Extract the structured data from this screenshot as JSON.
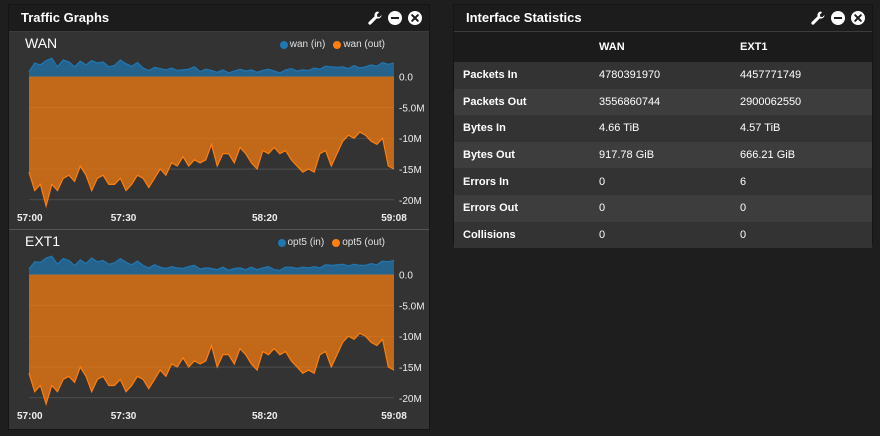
{
  "traffic_widget": {
    "title": "Traffic Graphs",
    "colors": {
      "in": "#1f77b4",
      "out": "#ff7f0e"
    },
    "graphs": [
      {
        "name": "WAN",
        "legend_in": "wan (in)",
        "legend_out": "wan (out)"
      },
      {
        "name": "EXT1",
        "legend_in": "opt5 (in)",
        "legend_out": "opt5 (out)"
      }
    ]
  },
  "stats_widget": {
    "title": "Interface Statistics",
    "columns": [
      "",
      "WAN",
      "EXT1"
    ],
    "rows": [
      {
        "label": "Packets In",
        "wan": "4780391970",
        "ext1": "4457771749"
      },
      {
        "label": "Packets Out",
        "wan": "3556860744",
        "ext1": "2900062550"
      },
      {
        "label": "Bytes In",
        "wan": "4.66 TiB",
        "ext1": "4.57 TiB"
      },
      {
        "label": "Bytes Out",
        "wan": "917.78 GiB",
        "ext1": "666.21 GiB"
      },
      {
        "label": "Errors In",
        "wan": "0",
        "ext1": "6"
      },
      {
        "label": "Errors Out",
        "wan": "0",
        "ext1": "0"
      },
      {
        "label": "Collisions",
        "wan": "0",
        "ext1": "0"
      }
    ]
  },
  "chart_data": [
    {
      "type": "area",
      "title": "WAN",
      "x_tick_labels": [
        "57:00",
        "57:30",
        "58:20",
        "59:08"
      ],
      "y_tick_labels": [
        "0.0",
        "-5.0M",
        "-10M",
        "-15M",
        "-20M"
      ],
      "ylim": [
        -21,
        4
      ],
      "x": [
        0,
        2,
        4,
        6,
        8,
        10,
        12,
        14,
        16,
        18,
        20,
        22,
        24,
        26,
        28,
        30,
        32,
        34,
        36,
        38,
        40,
        42,
        44,
        46,
        48,
        50,
        52,
        54,
        56,
        58,
        60,
        62,
        64,
        66,
        68,
        70,
        72,
        74,
        76,
        78,
        80,
        82,
        84,
        86,
        88,
        90,
        92,
        94,
        96,
        98,
        100,
        102,
        104,
        106,
        108,
        110,
        112,
        114,
        116,
        118,
        120,
        122,
        124,
        126,
        128
      ],
      "series": [
        {
          "name": "wan (in)",
          "values": [
            0.8,
            2.2,
            1.9,
            2.6,
            3.0,
            1.6,
            2.7,
            2.4,
            1.6,
            2.5,
            1.9,
            2.6,
            2.2,
            2.4,
            1.6,
            1.8,
            2.7,
            2.1,
            1.7,
            2.3,
            1.4,
            1.0,
            1.5,
            1.3,
            1.1,
            1.4,
            1.0,
            1.1,
            1.2,
            1.6,
            0.8,
            1.2,
            1.0,
            0.7,
            1.1,
            0.6,
            0.9,
            1.2,
            0.9,
            1.1,
            0.7,
            1.0,
            1.2,
            0.9,
            0.6,
            1.1,
            1.3,
            0.9,
            1.1,
            1.0,
            1.4,
            1.2,
            1.7,
            1.6,
            1.5,
            1.6,
            1.3,
            1.8,
            1.4,
            1.6,
            1.9,
            1.7,
            2.3,
            2.0,
            2.2
          ]
        },
        {
          "name": "wan (out)",
          "values": [
            -15.5,
            -18.5,
            -17.5,
            -21.0,
            -17.5,
            -18.5,
            -16.5,
            -16.0,
            -17.0,
            -14.5,
            -16.0,
            -18.5,
            -16.5,
            -16.0,
            -17.5,
            -17.5,
            -16.5,
            -18.5,
            -17.5,
            -16.0,
            -16.5,
            -18.0,
            -16.5,
            -15.0,
            -16.0,
            -14.0,
            -14.5,
            -13.0,
            -14.5,
            -13.5,
            -14.0,
            -13.5,
            -11.0,
            -14.5,
            -12.5,
            -12.5,
            -14.0,
            -11.5,
            -12.5,
            -14.0,
            -15.0,
            -12.0,
            -12.5,
            -11.5,
            -12.5,
            -12.0,
            -13.5,
            -14.5,
            -15.5,
            -15.0,
            -15.5,
            -12.5,
            -12.0,
            -14.5,
            -12.5,
            -10.5,
            -9.5,
            -10.0,
            -9.0,
            -9.5,
            -10.5,
            -11.0,
            -10.0,
            -14.5,
            -15.0
          ]
        }
      ]
    },
    {
      "type": "area",
      "title": "EXT1",
      "x_tick_labels": [
        "57:00",
        "57:30",
        "58:20",
        "59:08"
      ],
      "y_tick_labels": [
        "0.0",
        "-5.0M",
        "-10M",
        "-15M",
        "-20M"
      ],
      "ylim": [
        -21,
        4
      ],
      "x": [
        0,
        2,
        4,
        6,
        8,
        10,
        12,
        14,
        16,
        18,
        20,
        22,
        24,
        26,
        28,
        30,
        32,
        34,
        36,
        38,
        40,
        42,
        44,
        46,
        48,
        50,
        52,
        54,
        56,
        58,
        60,
        62,
        64,
        66,
        68,
        70,
        72,
        74,
        76,
        78,
        80,
        82,
        84,
        86,
        88,
        90,
        92,
        94,
        96,
        98,
        100,
        102,
        104,
        106,
        108,
        110,
        112,
        114,
        116,
        118,
        120,
        122,
        124,
        126,
        128
      ],
      "series": [
        {
          "name": "opt5 (in)",
          "values": [
            0.9,
            2.1,
            2.0,
            2.7,
            3.0,
            1.7,
            2.6,
            2.3,
            1.5,
            2.4,
            1.8,
            2.7,
            2.1,
            2.3,
            1.7,
            1.9,
            2.6,
            2.0,
            1.6,
            2.2,
            1.5,
            1.1,
            1.6,
            1.2,
            1.0,
            1.3,
            1.1,
            1.0,
            1.3,
            1.5,
            0.9,
            1.1,
            1.0,
            0.8,
            1.2,
            0.7,
            1.0,
            1.1,
            0.8,
            1.2,
            0.8,
            1.1,
            1.3,
            0.8,
            0.7,
            1.2,
            1.2,
            1.0,
            1.2,
            1.1,
            1.3,
            1.1,
            1.6,
            1.5,
            1.6,
            1.7,
            1.4,
            1.7,
            1.5,
            1.5,
            1.8,
            1.6,
            2.2,
            2.1,
            2.3
          ]
        },
        {
          "name": "opt5 (out)",
          "values": [
            -16.0,
            -19.0,
            -18.0,
            -21.0,
            -18.0,
            -19.0,
            -17.0,
            -16.5,
            -17.5,
            -15.0,
            -16.5,
            -19.0,
            -17.0,
            -16.5,
            -18.0,
            -18.0,
            -17.0,
            -19.0,
            -18.0,
            -16.5,
            -17.0,
            -18.5,
            -17.0,
            -15.5,
            -16.5,
            -14.5,
            -15.0,
            -13.5,
            -15.0,
            -14.0,
            -14.5,
            -14.0,
            -11.5,
            -15.0,
            -13.0,
            -13.0,
            -14.5,
            -12.0,
            -13.0,
            -14.5,
            -15.5,
            -12.5,
            -13.0,
            -12.0,
            -13.0,
            -12.5,
            -14.0,
            -15.0,
            -16.0,
            -15.5,
            -16.0,
            -13.0,
            -12.5,
            -15.0,
            -13.0,
            -11.0,
            -10.0,
            -10.5,
            -9.5,
            -10.0,
            -11.0,
            -11.5,
            -10.5,
            -15.0,
            -15.5
          ]
        }
      ]
    }
  ]
}
